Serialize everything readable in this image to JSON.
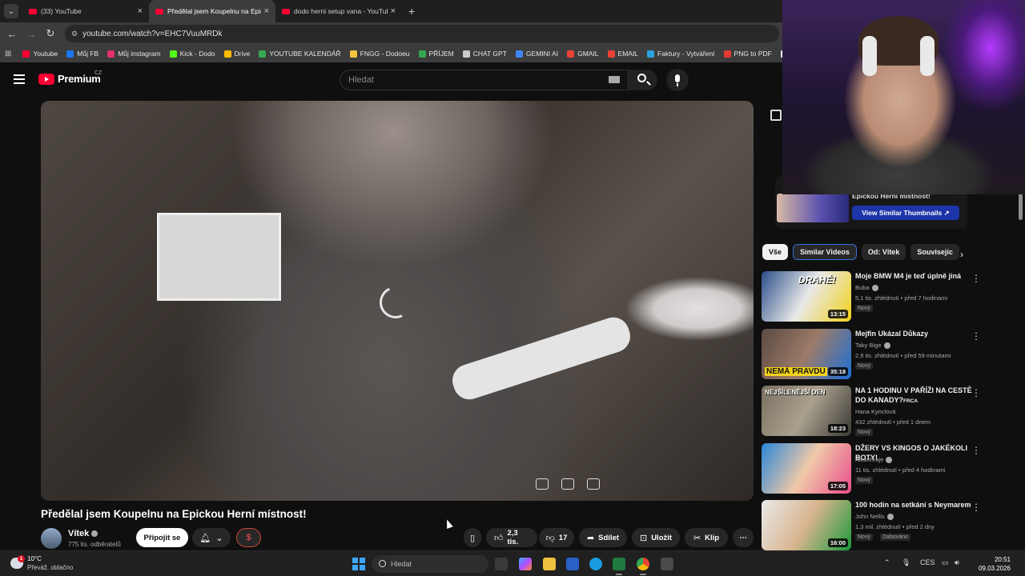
{
  "browser": {
    "tabs": [
      {
        "title": "(33) YouTube",
        "active": false
      },
      {
        "title": "Předělal jsem Koupelnu na Epic",
        "active": true
      },
      {
        "title": "dodo herni setup vana - YouTub",
        "active": false
      }
    ],
    "new_tab": "+",
    "url": "youtube.com/watch?v=EHC7VuuMRDk",
    "bookmarks": [
      {
        "label": "Youtube",
        "color": "#ff0033"
      },
      {
        "label": "Můj FB",
        "color": "#1877f2"
      },
      {
        "label": "Můj instagram",
        "color": "#e1306c"
      },
      {
        "label": "Kick - Dodo",
        "color": "#53fc18"
      },
      {
        "label": "Drive",
        "color": "#fbbc04"
      },
      {
        "label": "YOUTUBE KALENDÁŘ",
        "color": "#34a853"
      },
      {
        "label": "FNGG - Dodoeu",
        "color": "#f5c542"
      },
      {
        "label": "PŘÍJEM",
        "color": "#34a853"
      },
      {
        "label": "CHAT GPT",
        "color": "#cccccc"
      },
      {
        "label": "GEMINI AI",
        "color": "#4285f4"
      },
      {
        "label": "GMAIL",
        "color": "#ea4335"
      },
      {
        "label": "EMAIL",
        "color": "#ea4335"
      },
      {
        "label": "Faktury - Vytváření",
        "color": "#29a3e0"
      },
      {
        "label": "PNG to PDF",
        "color": "#e53935"
      },
      {
        "label": "S",
        "color": "#ffffff"
      }
    ]
  },
  "youtube": {
    "logo": "Premium",
    "logo_region": "CZ",
    "search_placeholder": "Hledat",
    "video": {
      "title": "Předělal jsem Koupelnu na Epickou Herní místnost!",
      "channel": "Vítek",
      "subscribers": "775 tis. odběratelů",
      "join_label": "Připojit se",
      "dollar_label": "$",
      "likes": "2,3 tis.",
      "dislikes": "17",
      "share_label": "Sdílet",
      "save_label": "Uložit",
      "clip_label": "Klip",
      "more_label": "⋯"
    },
    "extension": {
      "title": "Epickou Herní místnost!",
      "button": "View Similar Thumbnails ↗"
    },
    "chips": [
      "Vše",
      "Similar Videos",
      "Od: Vítek",
      "Souvisejíc"
    ],
    "recommendations": [
      {
        "title": "Moje BMW M4 je teď úplně jiná",
        "channel": "Buba",
        "meta": "5,1 tis. zhlédnutí • před 7 hodinami",
        "badge": "Nový",
        "duration": "13:15",
        "thumb_text": "DRAHÉ!",
        "colors": [
          "#2b4f8a",
          "#e8e8e8",
          "#f1d21a"
        ]
      },
      {
        "title": "Mejfin Ukázal Důkazy",
        "channel": "Taky Bige",
        "meta": "2,9 tis. zhlédnutí • před 59 minutami",
        "badge": "Nový",
        "duration": "35:18",
        "thumb_text": "NEMÁ PRAVDU",
        "colors": [
          "#5a4a42",
          "#9c7b68",
          "#1d6fd8"
        ]
      },
      {
        "title": "NA 1 HODINU V PAŘÍŽI NA CESTĚ DO KANADY?",
        "title_suffix": "FRCA",
        "channel": "Hana Kynclová",
        "meta": "432 zhlédnutí • před 1 dnem",
        "badge": "Nový",
        "duration": "18:23",
        "thumb_text": "NEJŠÍLENĚJŠÍ DEN",
        "colors": [
          "#7b7060",
          "#a9a08e",
          "#3c3a36"
        ]
      },
      {
        "title": "DŽERY VS KINGOS O JAKÉKOLI BOTY!",
        "channel": "Alkanhraje",
        "meta": "11 tis. zhlédnutí • před 4 hodinami",
        "badge": "Nový",
        "duration": "17:05",
        "thumb_text": "",
        "colors": [
          "#2a86d8",
          "#f0c9a8",
          "#e84b8a"
        ]
      },
      {
        "title": "100 hodin na setkání s Neymarem",
        "channel": "John Nellis",
        "meta": "1,3 mil. zhlédnutí • před 2 dny",
        "badge": "Nový",
        "badge2": "Dabováno",
        "duration": "16:00",
        "thumb_text": "",
        "colors": [
          "#e9e9e9",
          "#d8b48e",
          "#1c9a3c"
        ]
      }
    ]
  },
  "taskbar": {
    "weather_temp": "10°C",
    "weather_desc": "Převáž. oblačno",
    "weather_badge": "1",
    "search": "Hledat",
    "lang": "CES",
    "time": "20:51",
    "date": "09.03.2026"
  }
}
